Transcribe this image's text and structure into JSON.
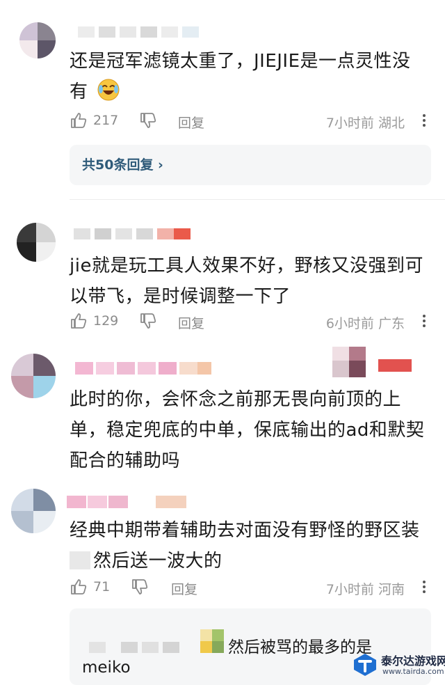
{
  "comments": [
    {
      "text": "还是冠军滤镜太重了，JIEJIE是一点灵性没有",
      "emoji": "laughing-crying-emoji",
      "likes": "217",
      "reply_label": "回复",
      "time": "7小时前",
      "location": "湖北",
      "reply_summary": "共50条回复 ›"
    },
    {
      "text": "jie就是玩工具人效果不好，野核又没强到可以带飞，是时候调整一下了",
      "likes": "129",
      "reply_label": "回复",
      "time": "6小时前",
      "location": "广东"
    },
    {
      "text": "此时的你，会怀念之前那无畏向前顶的上单，稳定兜底的中单，保底输出的ad和默契配合的辅助吗"
    },
    {
      "text_line1": "经典中期带着辅助去对面没有野怪的野区装",
      "text_line2": "然后送一波大的",
      "likes": "71",
      "reply_label": "回复",
      "time": "7小时前",
      "location": "河南",
      "sub_reply_text": "然后被骂的最多的是",
      "sub_reply_text2": "meiko"
    }
  ],
  "watermark": {
    "name": "泰尔达游戏网",
    "url": "www.tairda.com"
  },
  "colors": {
    "reply_link": "#2f5b7a",
    "meta_gray": "#9a9a9a",
    "reply_bg": "#f5f6f7"
  }
}
